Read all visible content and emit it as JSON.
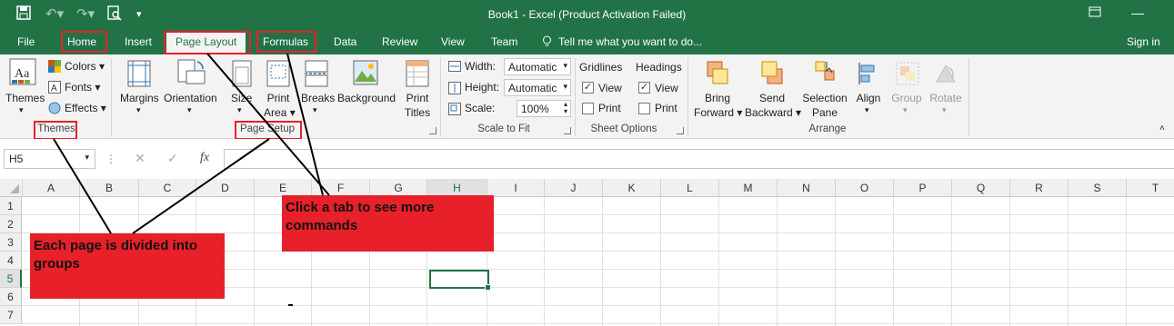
{
  "titlebar": {
    "title": "Book1 - Excel (Product Activation Failed)"
  },
  "tabs": [
    "File",
    "Home",
    "Insert",
    "Page Layout",
    "Formulas",
    "Data",
    "Review",
    "View",
    "Team"
  ],
  "tell_me": "Tell me what you want to do...",
  "sign_in": "Sign in",
  "ribbon": {
    "themes": {
      "themes": "Themes",
      "colors": "Colors",
      "fonts": "Fonts",
      "effects": "Effects",
      "group": "Themes"
    },
    "page_setup": {
      "margins": "Margins",
      "orientation": "Orientation",
      "size": "Size",
      "print": "Print",
      "area": "Area",
      "breaks": "Breaks",
      "background": "Background",
      "print2": "Print",
      "titles": "Titles",
      "group": "Page Setup"
    },
    "scale": {
      "width_label": "Width:",
      "width_value": "Automatic",
      "height_label": "Height:",
      "height_value": "Automatic",
      "scale_label": "Scale:",
      "scale_value": "100%",
      "group": "Scale to Fit"
    },
    "sheet_options": {
      "gridlines": "Gridlines",
      "headings": "Headings",
      "view": "View",
      "print": "Print",
      "group": "Sheet Options"
    },
    "arrange": {
      "bring": "Bring",
      "forward": "Forward",
      "send": "Send",
      "backward": "Backward",
      "selection": "Selection",
      "pane": "Pane",
      "align": "Align",
      "group_btn": "Group",
      "rotate": "Rotate",
      "group": "Arrange"
    }
  },
  "formula_bar": {
    "name_box": "H5",
    "fx": "fx"
  },
  "columns": [
    "A",
    "B",
    "C",
    "D",
    "E",
    "F",
    "G",
    "H",
    "I",
    "J",
    "K",
    "L",
    "M",
    "N",
    "O",
    "P",
    "Q",
    "R",
    "S",
    "T"
  ],
  "rows": [
    "1",
    "2",
    "3",
    "4",
    "5",
    "6",
    "7"
  ],
  "callouts": {
    "groups": "Each page is divided into groups",
    "tabs": "Click a tab to see more commands"
  },
  "colors": {
    "excel_green": "#217346",
    "callout_red": "#e8202a"
  }
}
